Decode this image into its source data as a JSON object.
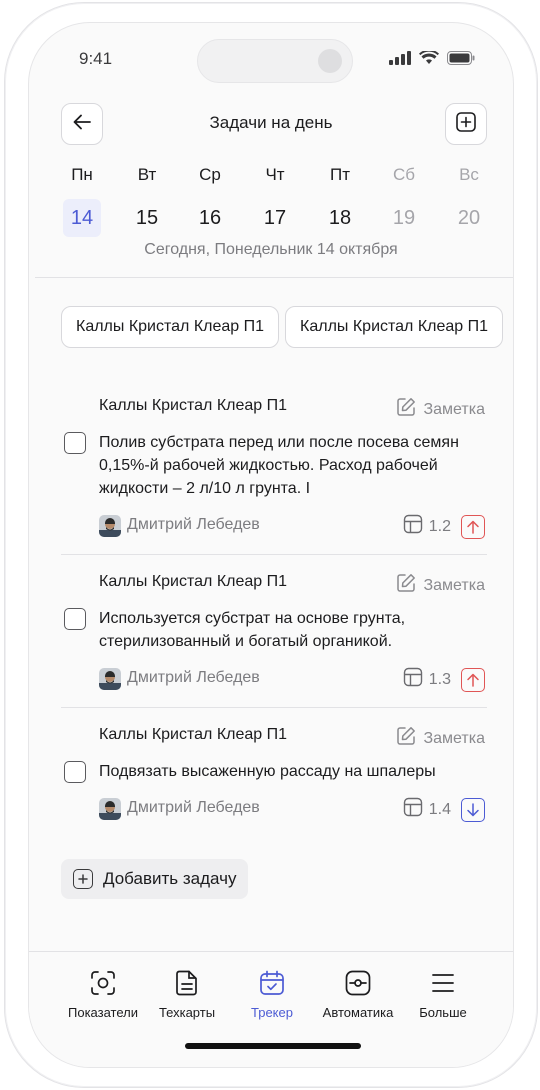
{
  "status_bar": {
    "time": "9:41"
  },
  "header": {
    "title": "Задачи на день"
  },
  "week": {
    "days": [
      {
        "name": "Пн",
        "num": "14"
      },
      {
        "name": "Вт",
        "num": "15"
      },
      {
        "name": "Ср",
        "num": "16"
      },
      {
        "name": "Чт",
        "num": "17"
      },
      {
        "name": "Пт",
        "num": "18"
      },
      {
        "name": "Сб",
        "num": "19"
      },
      {
        "name": "Вс",
        "num": "20"
      }
    ],
    "today_label": "Сегодня, Понедельник 14 октября"
  },
  "filters": {
    "chips": [
      "Каллы Кристал Клеар П1",
      "Каллы Кристал Клеар П1"
    ]
  },
  "tasks": [
    {
      "culture": "Каллы Кристал Клеар П1",
      "note_label": "Заметка",
      "text": "Полив субстрата перед или после посева семян 0,15%-й рабочей жидкостью. Расход рабочей жидкости – 2 л/10 л грунта. I",
      "assignee": "Дмитрий Лебедев",
      "step": "1.2",
      "priority_icon": "arrow-up-icon"
    },
    {
      "culture": "Каллы Кристал Клеар П1",
      "note_label": "Заметка",
      "text": "Используется субстрат на основе грунта, стерилизованный и богатый органикой.",
      "assignee": "Дмитрий Лебедев",
      "step": "1.3",
      "priority_icon": "arrow-up-icon"
    },
    {
      "culture": "Каллы Кристал Клеар П1",
      "note_label": "Заметка",
      "text": "Подвязать высаженную рассаду на шпалеры",
      "assignee": "Дмитрий Лебедев",
      "step": "1.4",
      "priority_icon": "arrow-down-icon"
    }
  ],
  "add_task": {
    "label": "Добавить задачу"
  },
  "tabbar": {
    "tabs": [
      {
        "label": "Показатели",
        "icon": "camera-scan-icon"
      },
      {
        "label": "Техкарты",
        "icon": "document-icon"
      },
      {
        "label": "Трекер",
        "icon": "calendar-check-icon"
      },
      {
        "label": "Автоматика",
        "icon": "automation-icon"
      },
      {
        "label": "Больше",
        "icon": "menu-icon"
      }
    ]
  },
  "colors": {
    "accent": "#4C5BD4",
    "priority_high": "#E05555",
    "muted": "#7C7C80"
  }
}
